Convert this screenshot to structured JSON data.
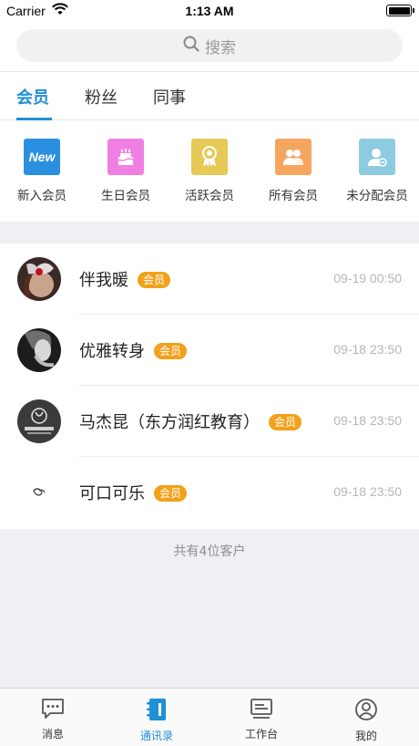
{
  "status_bar": {
    "carrier": "Carrier",
    "time": "1:13 AM"
  },
  "search": {
    "placeholder": "搜索"
  },
  "tabs": [
    {
      "label": "会员",
      "active": true
    },
    {
      "label": "粉丝",
      "active": false
    },
    {
      "label": "同事",
      "active": false
    }
  ],
  "categories": [
    {
      "label": "新入会员",
      "icon": "new-icon",
      "icon_text": "New",
      "color": "#2b8fe0"
    },
    {
      "label": "生日会员",
      "icon": "cake-icon",
      "color": "#f07fe3"
    },
    {
      "label": "活跃会员",
      "icon": "medal-icon",
      "color": "#e6c956"
    },
    {
      "label": "所有会员",
      "icon": "group-icon",
      "color": "#f6a55f"
    },
    {
      "label": "未分配会员",
      "icon": "unassigned-user-icon",
      "color": "#8ccbe0"
    }
  ],
  "contacts": [
    {
      "name": "伴我暖",
      "badge": "会员",
      "time": "09-19 00:50"
    },
    {
      "name": "优雅转身",
      "badge": "会员",
      "time": "09-18 23:50"
    },
    {
      "name": "马杰昆（东方润红教育）",
      "badge": "会员",
      "time": "09-18 23:50"
    },
    {
      "name": "可口可乐",
      "badge": "会员",
      "time": "09-18 23:50"
    }
  ],
  "summary": "共有4位客户",
  "tabbar": [
    {
      "label": "消息",
      "icon": "message-icon",
      "active": false
    },
    {
      "label": "通讯录",
      "icon": "contacts-icon",
      "active": true
    },
    {
      "label": "工作台",
      "icon": "workbench-icon",
      "active": false
    },
    {
      "label": "我的",
      "icon": "profile-icon",
      "active": false
    }
  ],
  "colors": {
    "accent": "#1f8fd6",
    "badge": "#f2a11b"
  }
}
